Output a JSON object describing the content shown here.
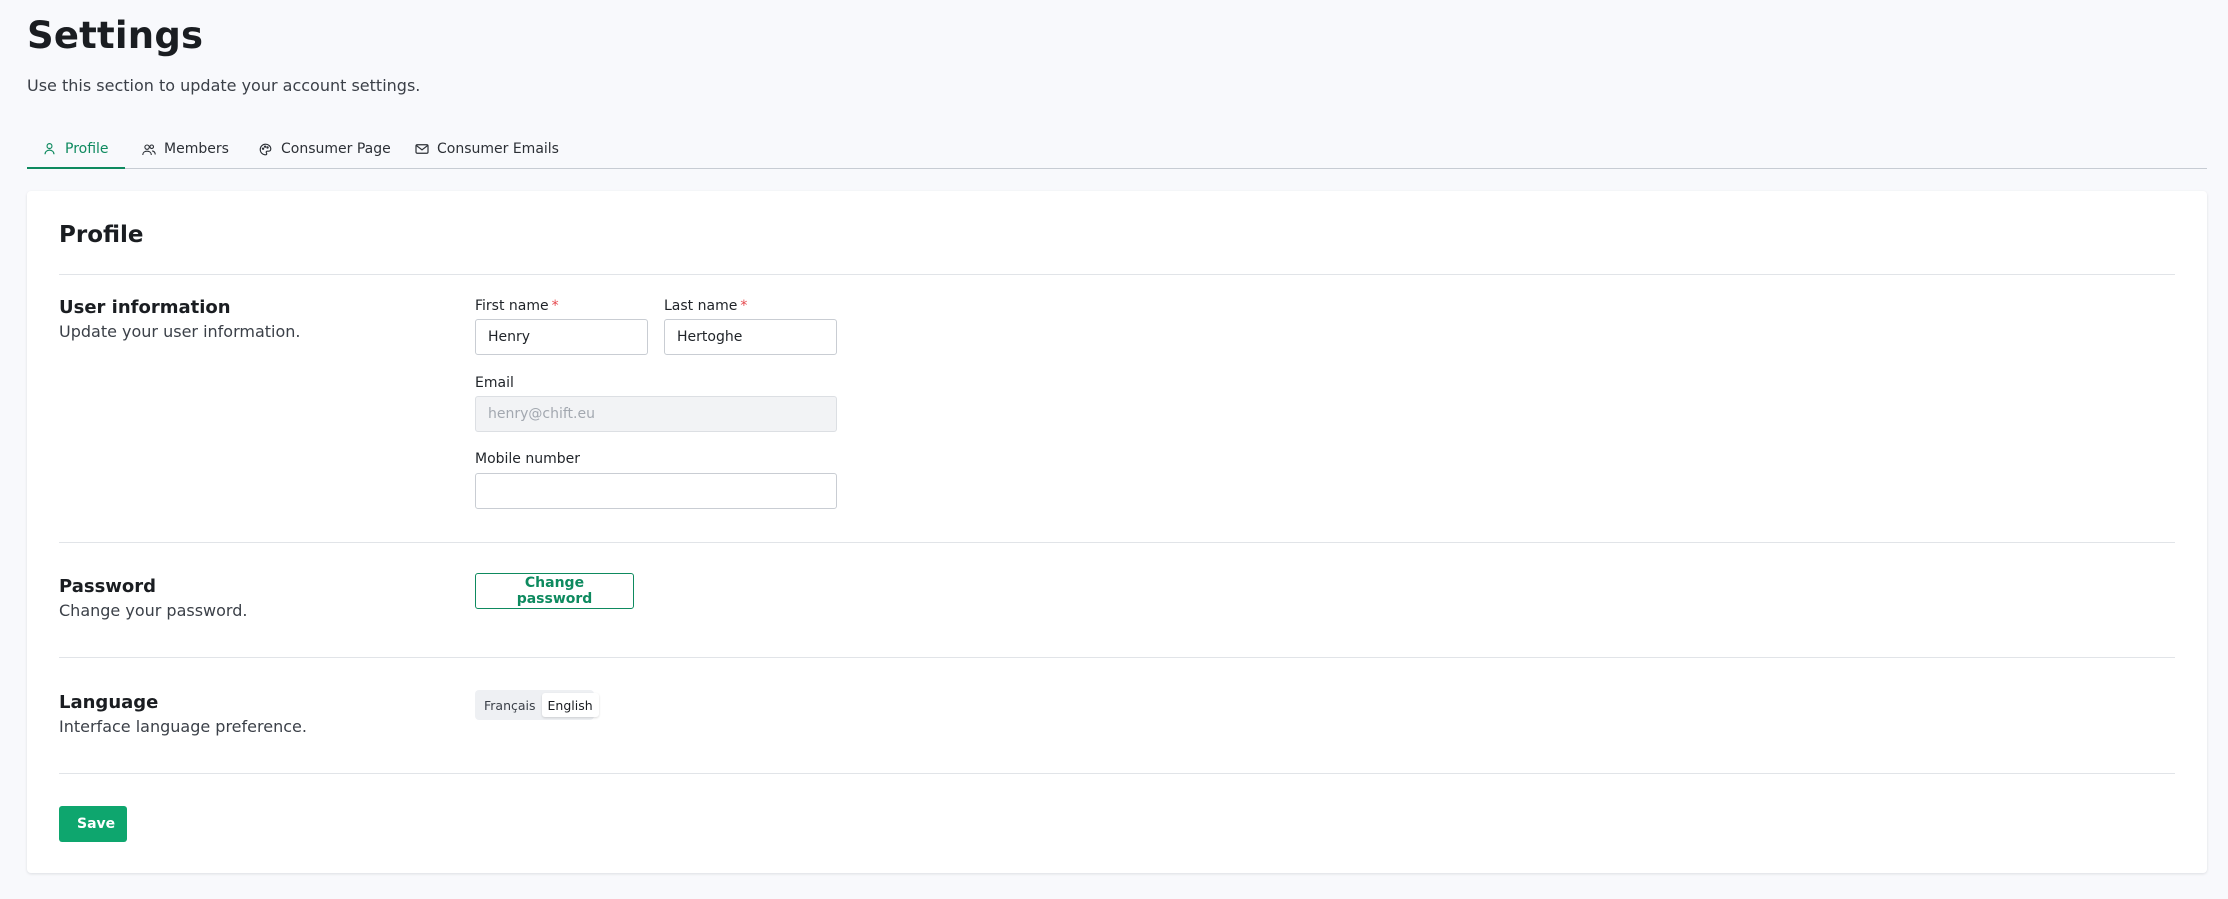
{
  "header": {
    "title": "Settings",
    "subtitle": "Use this section to update your account settings."
  },
  "tabs": [
    {
      "label": "Profile",
      "icon": "user-icon",
      "active": true
    },
    {
      "label": "Members",
      "icon": "users-icon",
      "active": false
    },
    {
      "label": "Consumer Page",
      "icon": "palette-icon",
      "active": false
    },
    {
      "label": "Consumer Emails",
      "icon": "mail-icon",
      "active": false
    }
  ],
  "profile": {
    "title": "Profile",
    "user_info": {
      "title": "User information",
      "description": "Update your user information.",
      "first_name": {
        "label": "First name",
        "required_mark": "*",
        "value": "Henry"
      },
      "last_name": {
        "label": "Last name",
        "required_mark": "*",
        "value": "Hertoghe"
      },
      "email": {
        "label": "Email",
        "placeholder": "henry@chift.eu",
        "disabled": true
      },
      "mobile": {
        "label": "Mobile number",
        "value": ""
      }
    },
    "password": {
      "title": "Password",
      "description": "Change your password.",
      "button_label": "Change password"
    },
    "language": {
      "title": "Language",
      "description": "Interface language preference.",
      "options": [
        "Français",
        "English"
      ],
      "selected": "English"
    },
    "save_label": "Save"
  },
  "colors": {
    "accent": "#0e8a5f",
    "primary_button": "#0ea66e",
    "required": "#e5484d",
    "background": "#f8f9fc"
  }
}
